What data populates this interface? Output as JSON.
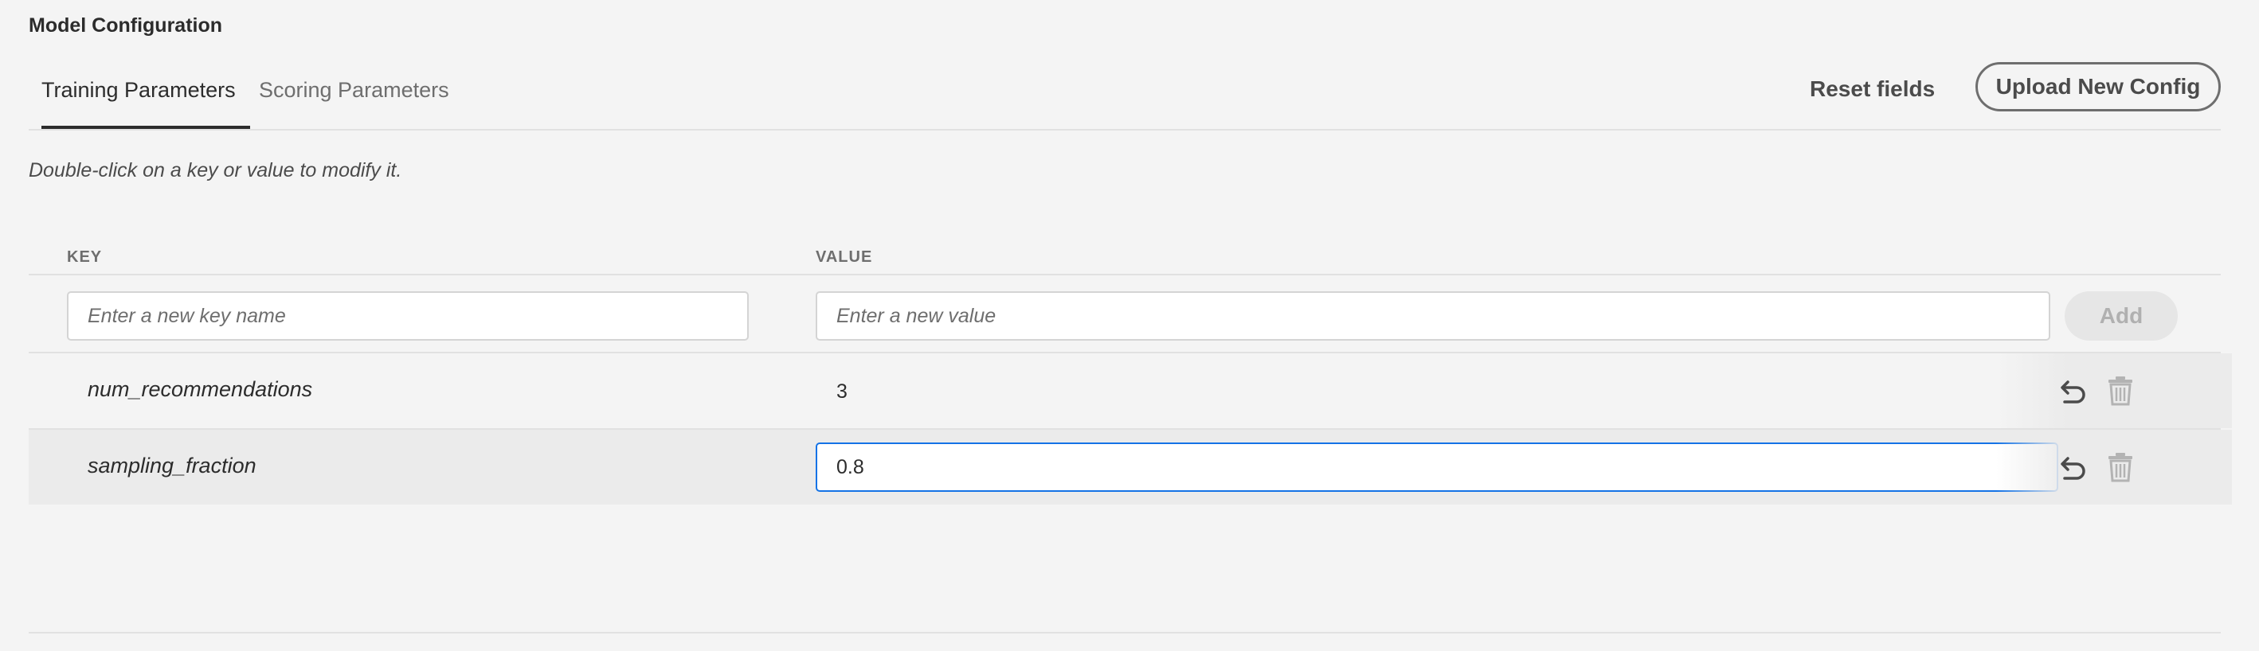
{
  "page": {
    "title": "Model Configuration",
    "hint": "Double-click on a key or value to modify it."
  },
  "tabs": [
    {
      "label": "Training Parameters",
      "active": true
    },
    {
      "label": "Scoring Parameters",
      "active": false
    }
  ],
  "toolbar": {
    "reset_label": "Reset fields",
    "upload_label": "Upload New Config"
  },
  "table": {
    "columns": {
      "key": "KEY",
      "value": "VALUE"
    },
    "new_entry": {
      "key_placeholder": "Enter a new key name",
      "value_placeholder": "Enter a new value",
      "add_label": "Add"
    },
    "rows": [
      {
        "key": "num_recommendations",
        "value": "3",
        "editing": false
      },
      {
        "key": "sampling_fraction",
        "value": "0.8",
        "editing": true
      }
    ]
  },
  "icons": {
    "undo": "undo-icon",
    "delete": "trash-icon"
  },
  "colors": {
    "accent": "#1473e6",
    "background": "#f4f4f4",
    "text": "#2c2c2c"
  }
}
